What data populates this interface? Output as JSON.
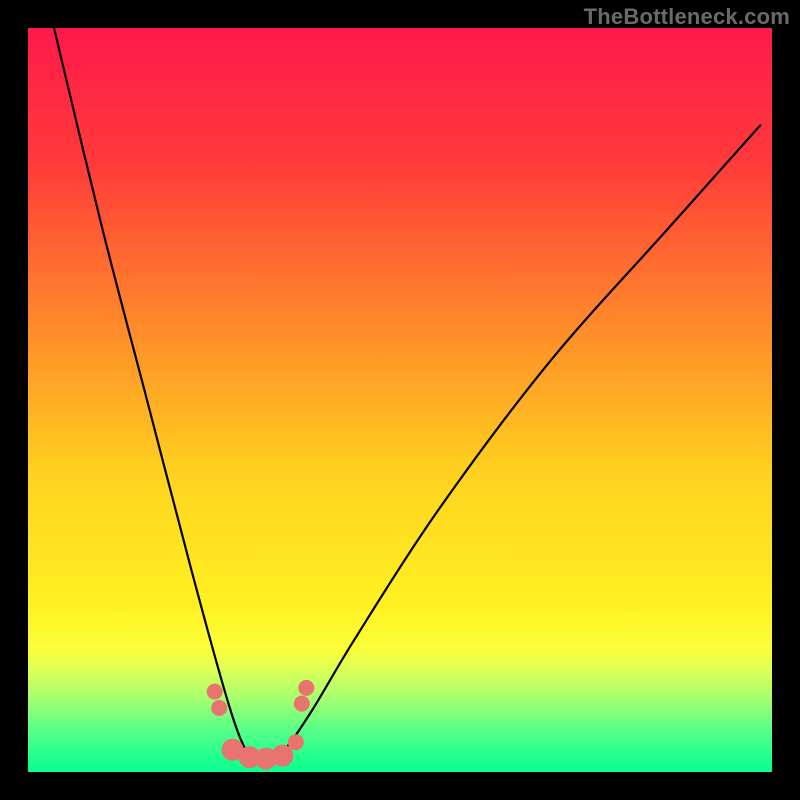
{
  "watermark": "TheBottleneck.com",
  "chart_data": {
    "type": "line",
    "title": "",
    "xlabel": "",
    "ylabel": "",
    "xlim": [
      0,
      744
    ],
    "ylim": [
      0,
      744
    ],
    "gradient_stops": [
      {
        "offset": 0.0,
        "color": "#ff1a4b"
      },
      {
        "offset": 0.18,
        "color": "#ff3a3a"
      },
      {
        "offset": 0.4,
        "color": "#ff8a2a"
      },
      {
        "offset": 0.6,
        "color": "#ffd21f"
      },
      {
        "offset": 0.78,
        "color": "#fff223"
      },
      {
        "offset": 0.835,
        "color": "#fbff3a"
      },
      {
        "offset": 0.86,
        "color": "#dfff55"
      },
      {
        "offset": 0.9,
        "color": "#a8ff6e"
      },
      {
        "offset": 0.94,
        "color": "#5dff87"
      },
      {
        "offset": 0.985,
        "color": "#1aff90"
      },
      {
        "offset": 1.0,
        "color": "#0cff90"
      }
    ],
    "curve": {
      "description": "Bottleneck curve: steep descent from upper-left, minimum near x≈0.31, then rising to the right",
      "x": [
        0.035,
        0.1,
        0.16,
        0.22,
        0.27,
        0.295,
        0.31,
        0.34,
        0.38,
        0.44,
        0.55,
        0.7,
        0.86,
        0.985
      ],
      "y": [
        1.0,
        0.73,
        0.5,
        0.27,
        0.09,
        0.025,
        0.015,
        0.025,
        0.08,
        0.18,
        0.35,
        0.55,
        0.73,
        0.87
      ]
    },
    "markers": {
      "color": "#e8746f",
      "r_small": 8,
      "r_large": 11,
      "points": [
        {
          "x": 0.251,
          "y": 0.108,
          "r": "small"
        },
        {
          "x": 0.257,
          "y": 0.086,
          "r": "small"
        },
        {
          "x": 0.275,
          "y": 0.03,
          "r": "large"
        },
        {
          "x": 0.298,
          "y": 0.02,
          "r": "large"
        },
        {
          "x": 0.32,
          "y": 0.018,
          "r": "large"
        },
        {
          "x": 0.342,
          "y": 0.022,
          "r": "large"
        },
        {
          "x": 0.36,
          "y": 0.04,
          "r": "small"
        },
        {
          "x": 0.368,
          "y": 0.092,
          "r": "small"
        },
        {
          "x": 0.374,
          "y": 0.113,
          "r": "small"
        }
      ]
    }
  }
}
